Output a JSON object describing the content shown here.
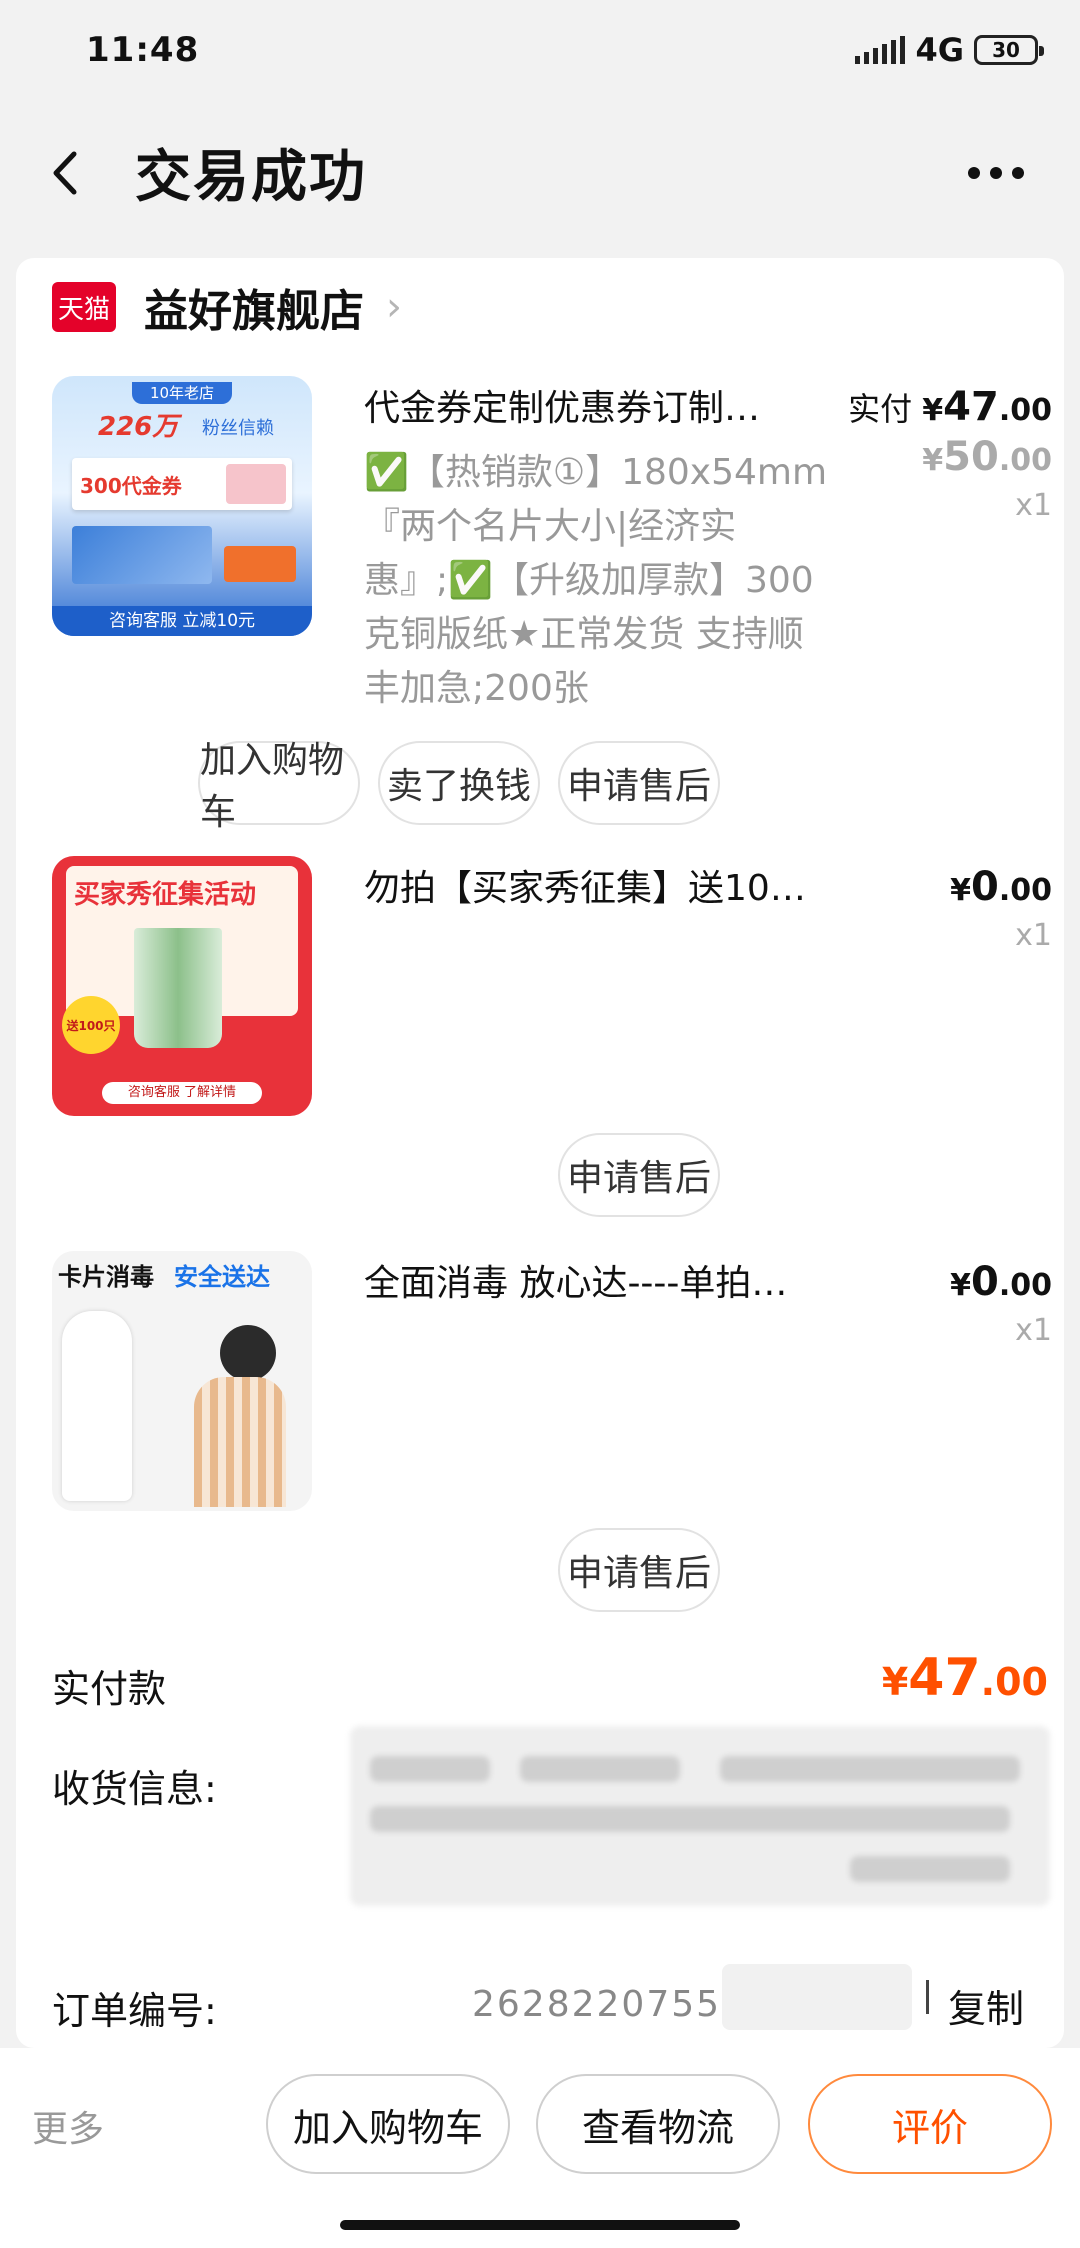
{
  "status_bar": {
    "time": "11:48",
    "network": "4G",
    "battery": "30"
  },
  "nav": {
    "title": "交易成功"
  },
  "shop": {
    "badge": "天猫",
    "name": "益好旗舰店"
  },
  "items": [
    {
      "title": "代金券定制优惠券订制…",
      "spec": "✅【热销款①】180x54mm『两个名片大小|经济实惠』;✅【升级加厚款】300克铜版纸★正常发货 支持顺丰加急;200张",
      "paid_label": "实付",
      "currency": "¥",
      "price_int": "47",
      "price_dec": ".00",
      "orig_int": "50",
      "orig_dec": ".00",
      "qty": "x1",
      "thumb": {
        "badge": "10年老店",
        "headline_num": "226万",
        "headline_text": "粉丝信赖",
        "coupon": "300代金券",
        "footer": "咨询客服 立减10元"
      },
      "buttons": [
        "加入购物车",
        "卖了换钱",
        "申请售后"
      ]
    },
    {
      "title": "勿拍【买家秀征集】送100只…",
      "currency": "¥",
      "price_int": "0",
      "price_dec": ".00",
      "qty": "x1",
      "thumb": {
        "headline": "买家秀征集活动",
        "badge": "送100只",
        "footer": "咨询客服 了解详情"
      },
      "buttons": [
        "申请售后"
      ]
    },
    {
      "title": "全面消毒 放心达----单拍不…",
      "currency": "¥",
      "price_int": "0",
      "price_dec": ".00",
      "qty": "x1",
      "thumb": {
        "headline_dark": "卡片消毒",
        "headline_accent": "安全送达"
      },
      "buttons": [
        "申请售后"
      ]
    }
  ],
  "summary": {
    "paid_label": "实付款",
    "currency": "¥",
    "total_int": "47",
    "total_dec": ".00",
    "address_label": "收货信息:",
    "order_label": "订单编号:",
    "order_number": "262822075519",
    "copy_label": "复制"
  },
  "bottom_bar": {
    "more": "更多",
    "add_cart": "加入购物车",
    "logistics": "查看物流",
    "review": "评价"
  },
  "colors": {
    "accent": "#ff5000",
    "tmall_red": "#e4022a",
    "background": "#f2f2f2"
  }
}
